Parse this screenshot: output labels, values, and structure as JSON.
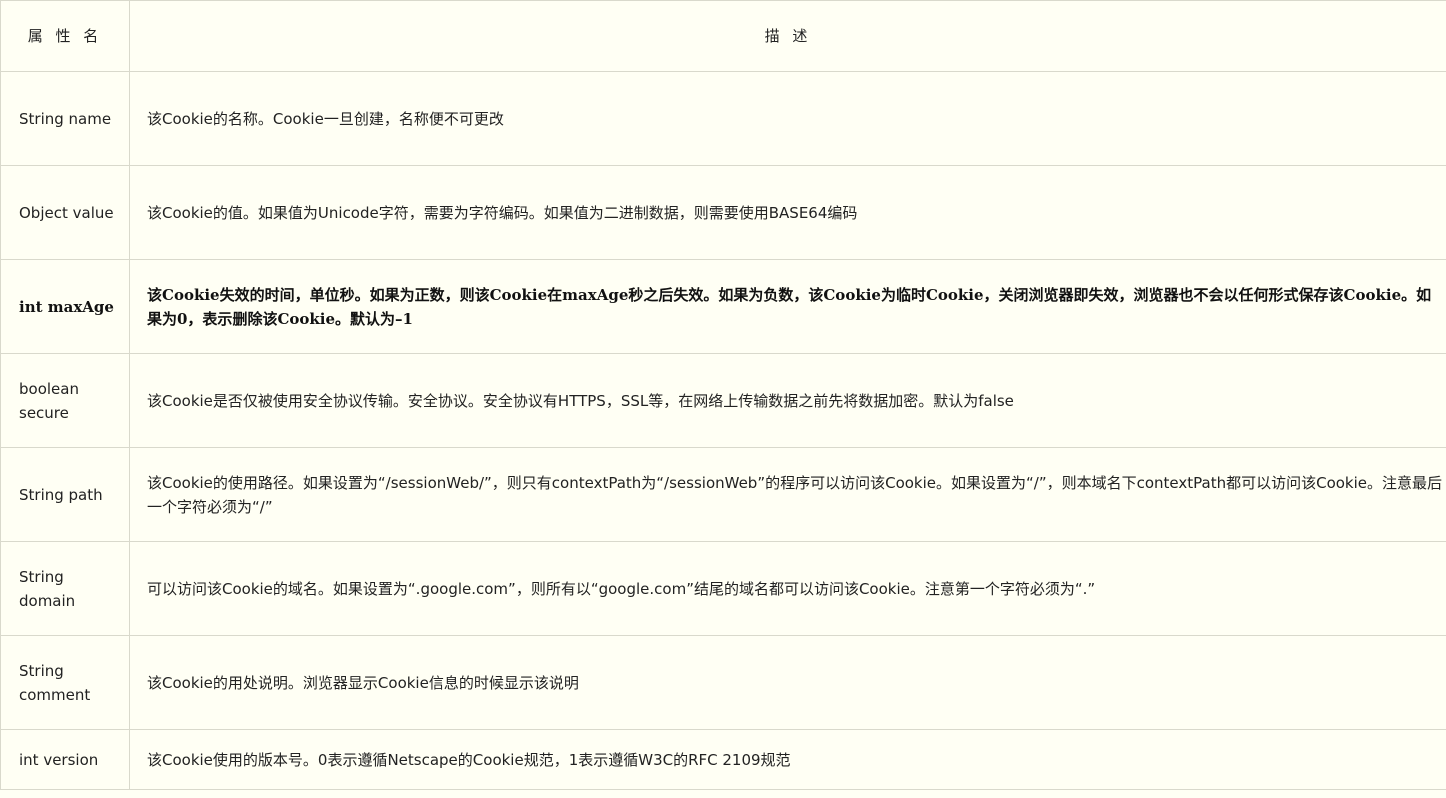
{
  "table": {
    "headers": {
      "name": "属 性 名",
      "desc": "描  述"
    },
    "rows": [
      {
        "name": "String name",
        "desc": "该Cookie的名称。Cookie一旦创建，名称便不可更改"
      },
      {
        "name": "Object value",
        "desc": "该Cookie的值。如果值为Unicode字符，需要为字符编码。如果值为二进制数据，则需要使用BASE64编码"
      },
      {
        "name": "int maxAge",
        "desc": "该Cookie失效的时间，单位秒。如果为正数，则该Cookie在maxAge秒之后失效。如果为负数，该Cookie为临时Cookie，关闭浏览器即失效，浏览器也不会以任何形式保存该Cookie。如果为0，表示删除该Cookie。默认为–1"
      },
      {
        "name": "boolean secure",
        "desc": "该Cookie是否仅被使用安全协议传输。安全协议。安全协议有HTTPS，SSL等，在网络上传输数据之前先将数据加密。默认为false"
      },
      {
        "name": "String path",
        "desc": "该Cookie的使用路径。如果设置为“/sessionWeb/”，则只有contextPath为“/sessionWeb”的程序可以访问该Cookie。如果设置为“/”，则本域名下contextPath都可以访问该Cookie。注意最后一个字符必须为“/”"
      },
      {
        "name": "String domain",
        "desc": "可以访问该Cookie的域名。如果设置为“.google.com”，则所有以“google.com”结尾的域名都可以访问该Cookie。注意第一个字符必须为“.”"
      },
      {
        "name": "String comment",
        "desc": "该Cookie的用处说明。浏览器显示Cookie信息的时候显示该说明"
      },
      {
        "name": "int version",
        "desc": "该Cookie使用的版本号。0表示遵循Netscape的Cookie规范，1表示遵循W3C的RFC 2109规范"
      }
    ]
  }
}
